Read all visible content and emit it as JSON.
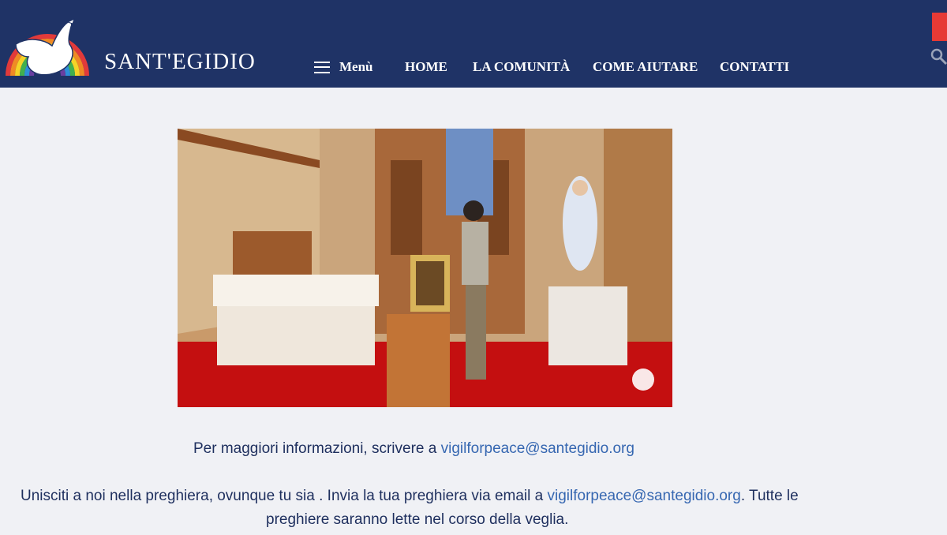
{
  "header": {
    "brand": "SANT'EGIDIO",
    "menu_label": "Menù",
    "nav": [
      "HOME",
      "LA COMUNITÀ",
      "COME AIUTARE",
      "CONTATTI"
    ]
  },
  "main": {
    "info_prefix": "Per maggiori informazioni, scrivere a ",
    "email": "vigilforpeace@santegidio.org",
    "join_prefix": "Unisciti a noi nella preghiera, ovunque tu sia . Invia la tua preghiera via email a ",
    "join_suffix": ". Tutte le",
    "join_line2": "preghiere saranno lette nel corso della veglia."
  },
  "colors": {
    "header_bg": "#1f3366",
    "text": "#1e2f5e",
    "link": "#3667b1",
    "accent": "#e63a35"
  }
}
